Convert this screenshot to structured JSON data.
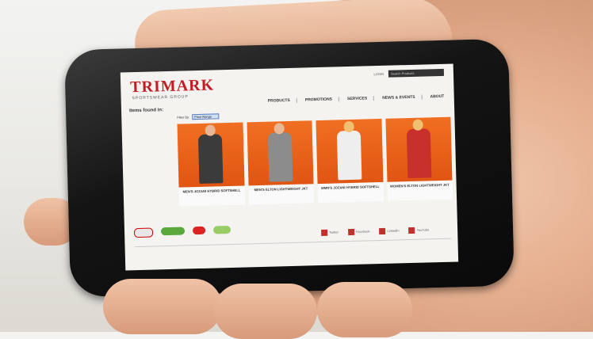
{
  "site": {
    "logo": "TRIMARK",
    "logo_sub": "SPORTSWEAR GROUP",
    "top_links": [
      "LOGIN"
    ],
    "search_placeholder": "Search Products",
    "nav": [
      "PRODUCTS",
      "PROMOTIONS",
      "SERVICES",
      "NEWS & EVENTS",
      "ABOUT"
    ],
    "items_found": "Items found in:",
    "filter_label": "Filter By:",
    "filter_value": "Price Range"
  },
  "products": [
    {
      "name": "MEN'S JOZANI HYBRID SOFTSHELL",
      "color": "#3b3b3b"
    },
    {
      "name": "MEN'S ELTON LIGHTWEIGHT JKT",
      "color": "#8c8c8c"
    },
    {
      "name": "WMN'S JOZANI HYBRID SOFTSHELL",
      "color": "#eeeeee"
    },
    {
      "name": "WOMEN'S ELTON LIGHTWEIGHT JKT",
      "color": "#c8302b"
    }
  ],
  "social": [
    "Twitter",
    "Facebook",
    "LinkedIn",
    "YouTube"
  ],
  "colors": {
    "brand": "#c11d26",
    "product_bg": "#ee6a1e"
  }
}
